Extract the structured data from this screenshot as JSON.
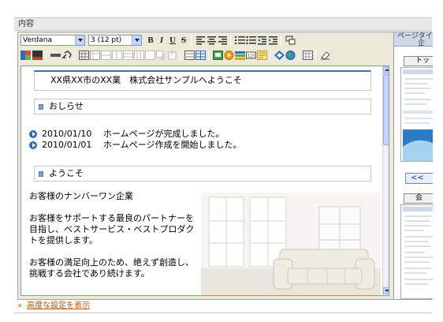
{
  "section": {
    "label": "内容"
  },
  "toolbar": {
    "font_family": "Verdana",
    "font_size": "3 (12 pt)",
    "bold": "B",
    "italic": "I",
    "underline": "U",
    "strike": "S"
  },
  "content": {
    "title": "XX県XX市のXX業　株式会社サンプルへようこそ",
    "news_heading": "おしらせ",
    "news": [
      {
        "date": "2010/01/10",
        "text": "ホームページが完成しました。"
      },
      {
        "date": "2010/01/01",
        "text": "ホームページ作成を開始しました。"
      }
    ],
    "welcome_heading": "ようこそ",
    "welcome_paragraphs": [
      "お客様のナンバーワン企業",
      "お客様をサポートする最良のパートナーを目指し、ベストサービス・ベストプロダクトを提供します。",
      "お客様の満足向上のため、絶えず創造し、挑戦する会社であり続けます。"
    ]
  },
  "sidebar": {
    "header": "ページタイン",
    "sub": "企",
    "thumb1_label": "トッ",
    "nav_label": "<<",
    "thumb2_label": "会"
  },
  "footer": {
    "advanced_chevron": "»",
    "advanced_link": "高度な設定を表示"
  },
  "colors": {
    "accent": "#4a6fa5",
    "link": "#b85400",
    "bullet": "#2e6cb7"
  }
}
